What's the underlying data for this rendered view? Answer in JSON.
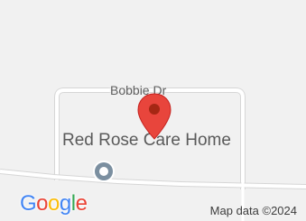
{
  "map": {
    "street_name": "Bobbie Dr",
    "place_name": "Red Rose Care Home",
    "marker_icon": "map-pin-icon",
    "place_icon": "place-dot-icon",
    "marker_color": "#e8453c",
    "marker_dot_color": "#a52714",
    "road_color": "#ffffff",
    "road_outline_color": "#d6d6d6",
    "background_color": "#f1f1f1"
  },
  "footer": {
    "logo_text": "Google",
    "logo_letters": [
      {
        "char": "G",
        "color": "#4285f4"
      },
      {
        "char": "o",
        "color": "#ea4335"
      },
      {
        "char": "o",
        "color": "#fbbc05"
      },
      {
        "char": "g",
        "color": "#4285f4"
      },
      {
        "char": "l",
        "color": "#34a853"
      },
      {
        "char": "e",
        "color": "#ea4335"
      }
    ],
    "attribution": "Map data ©2024"
  }
}
